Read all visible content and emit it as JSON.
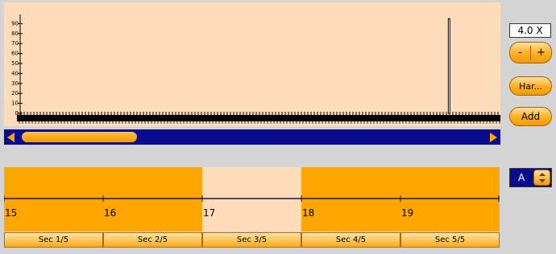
{
  "plot": {
    "y_tick_labels": [
      "0",
      "10",
      "20",
      "30",
      "40",
      "50",
      "60",
      "70",
      "80",
      "90"
    ],
    "spike_value": 95,
    "spike_position_fraction": 0.895
  },
  "scrollbar": {
    "thumb_fraction": 0.25
  },
  "zoom": {
    "value": "4.0 X",
    "minus_label": "-",
    "plus_label": "+"
  },
  "buttons": {
    "harmonics_label": "Har...",
    "add_label": "Add"
  },
  "timeline": {
    "tick_labels": [
      "15",
      "16",
      "17",
      "18",
      "19"
    ],
    "selected_section": 3
  },
  "sections": [
    {
      "label": "Sec 1/5"
    },
    {
      "label": "Sec 2/5"
    },
    {
      "label": "Sec 3/5"
    },
    {
      "label": "Sec 4/5"
    },
    {
      "label": "Sec 5/5"
    }
  ],
  "channel": {
    "label": "A"
  },
  "colors": {
    "plot_bg": "#ffdcb9",
    "accent_orange": "#ffa500",
    "scroll_blue": "#0a0a8c"
  }
}
